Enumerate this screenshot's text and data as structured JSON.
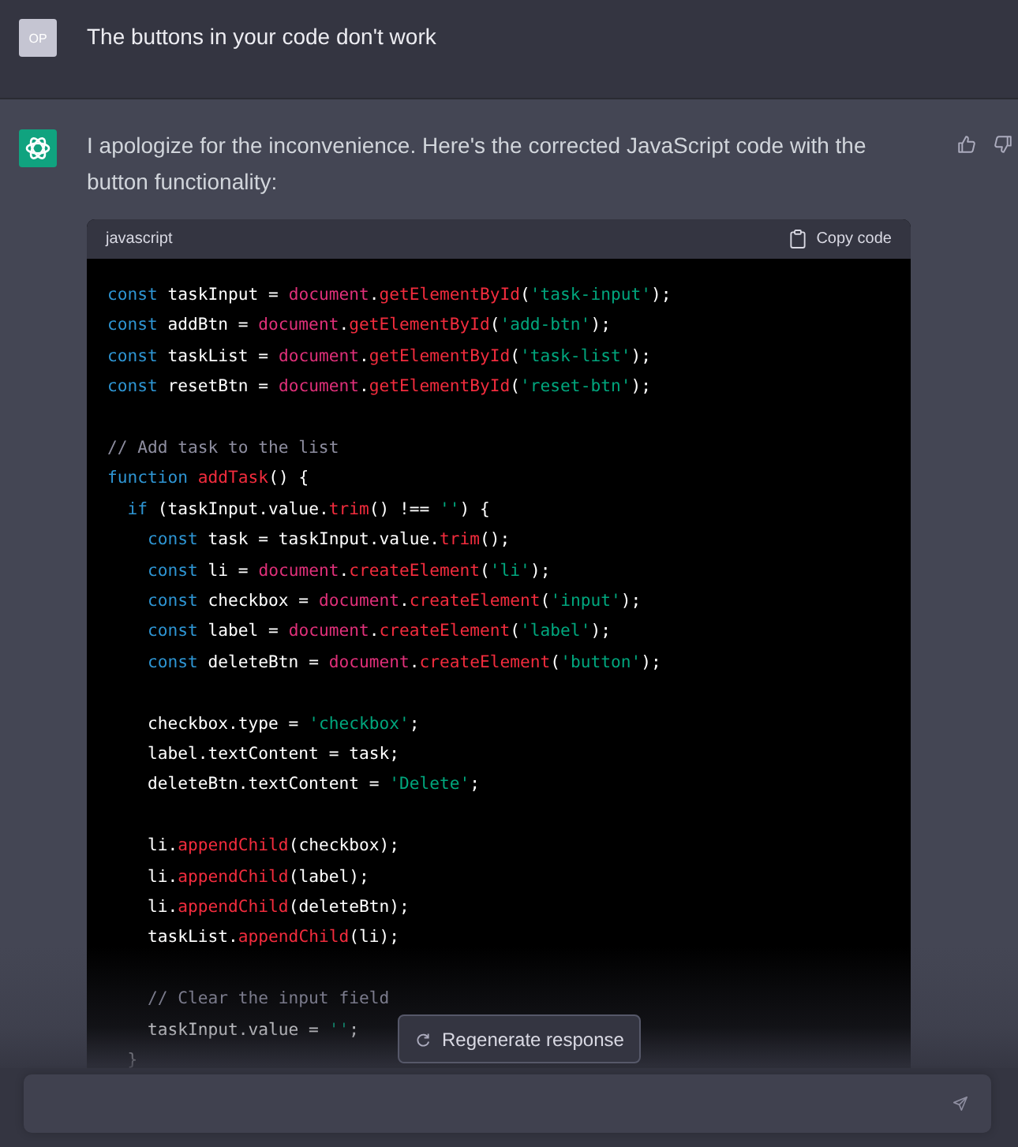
{
  "user_message": {
    "avatar": "OP",
    "text": "The buttons in your code don't work"
  },
  "assistant_message": {
    "text": "I apologize for the inconvenience. Here's the corrected JavaScript code with the button functionality:",
    "code_block": {
      "language": "javascript",
      "copy_label": "Copy code",
      "lines": [
        {
          "kind": "code",
          "tokens": [
            {
              "kind": "keyword",
              "text": "const"
            },
            {
              "kind": "plain",
              "text": " taskInput = "
            },
            {
              "kind": "object",
              "text": "document"
            },
            {
              "kind": "plain",
              "text": "."
            },
            {
              "kind": "method",
              "text": "getElementById"
            },
            {
              "kind": "plain",
              "text": "("
            },
            {
              "kind": "string",
              "text": "'task-input'"
            },
            {
              "kind": "plain",
              "text": ");"
            }
          ]
        },
        {
          "kind": "code",
          "tokens": [
            {
              "kind": "keyword",
              "text": "const"
            },
            {
              "kind": "plain",
              "text": " addBtn = "
            },
            {
              "kind": "object",
              "text": "document"
            },
            {
              "kind": "plain",
              "text": "."
            },
            {
              "kind": "method",
              "text": "getElementById"
            },
            {
              "kind": "plain",
              "text": "("
            },
            {
              "kind": "string",
              "text": "'add-btn'"
            },
            {
              "kind": "plain",
              "text": ");"
            }
          ]
        },
        {
          "kind": "code",
          "tokens": [
            {
              "kind": "keyword",
              "text": "const"
            },
            {
              "kind": "plain",
              "text": " taskList = "
            },
            {
              "kind": "object",
              "text": "document"
            },
            {
              "kind": "plain",
              "text": "."
            },
            {
              "kind": "method",
              "text": "getElementById"
            },
            {
              "kind": "plain",
              "text": "("
            },
            {
              "kind": "string",
              "text": "'task-list'"
            },
            {
              "kind": "plain",
              "text": ");"
            }
          ]
        },
        {
          "kind": "code",
          "tokens": [
            {
              "kind": "keyword",
              "text": "const"
            },
            {
              "kind": "plain",
              "text": " resetBtn = "
            },
            {
              "kind": "object",
              "text": "document"
            },
            {
              "kind": "plain",
              "text": "."
            },
            {
              "kind": "method",
              "text": "getElementById"
            },
            {
              "kind": "plain",
              "text": "("
            },
            {
              "kind": "string",
              "text": "'reset-btn'"
            },
            {
              "kind": "plain",
              "text": ");"
            }
          ]
        },
        {
          "kind": "blank"
        },
        {
          "kind": "code",
          "tokens": [
            {
              "kind": "comment",
              "text": "// Add task to the list"
            }
          ]
        },
        {
          "kind": "code",
          "tokens": [
            {
              "kind": "keyword",
              "text": "function "
            },
            {
              "kind": "method",
              "text": "addTask"
            },
            {
              "kind": "plain",
              "text": "() {"
            }
          ]
        },
        {
          "kind": "code",
          "tokens": [
            {
              "kind": "keyword",
              "text": "  if"
            },
            {
              "kind": "plain",
              "text": " (taskInput.value."
            },
            {
              "kind": "method",
              "text": "trim"
            },
            {
              "kind": "plain",
              "text": "() !== "
            },
            {
              "kind": "string",
              "text": "''"
            },
            {
              "kind": "plain",
              "text": ") {"
            }
          ]
        },
        {
          "kind": "code",
          "tokens": [
            {
              "kind": "keyword",
              "text": "    const"
            },
            {
              "kind": "plain",
              "text": " task = taskInput.value."
            },
            {
              "kind": "method",
              "text": "trim"
            },
            {
              "kind": "plain",
              "text": "();"
            }
          ]
        },
        {
          "kind": "code",
          "tokens": [
            {
              "kind": "keyword",
              "text": "    const"
            },
            {
              "kind": "plain",
              "text": " li = "
            },
            {
              "kind": "object",
              "text": "document"
            },
            {
              "kind": "plain",
              "text": "."
            },
            {
              "kind": "method",
              "text": "createElement"
            },
            {
              "kind": "plain",
              "text": "("
            },
            {
              "kind": "string",
              "text": "'li'"
            },
            {
              "kind": "plain",
              "text": ");"
            }
          ]
        },
        {
          "kind": "code",
          "tokens": [
            {
              "kind": "keyword",
              "text": "    const"
            },
            {
              "kind": "plain",
              "text": " checkbox = "
            },
            {
              "kind": "object",
              "text": "document"
            },
            {
              "kind": "plain",
              "text": "."
            },
            {
              "kind": "method",
              "text": "createElement"
            },
            {
              "kind": "plain",
              "text": "("
            },
            {
              "kind": "string",
              "text": "'input'"
            },
            {
              "kind": "plain",
              "text": ");"
            }
          ]
        },
        {
          "kind": "code",
          "tokens": [
            {
              "kind": "keyword",
              "text": "    const"
            },
            {
              "kind": "plain",
              "text": " label = "
            },
            {
              "kind": "object",
              "text": "document"
            },
            {
              "kind": "plain",
              "text": "."
            },
            {
              "kind": "method",
              "text": "createElement"
            },
            {
              "kind": "plain",
              "text": "("
            },
            {
              "kind": "string",
              "text": "'label'"
            },
            {
              "kind": "plain",
              "text": ");"
            }
          ]
        },
        {
          "kind": "code",
          "tokens": [
            {
              "kind": "keyword",
              "text": "    const"
            },
            {
              "kind": "plain",
              "text": " deleteBtn = "
            },
            {
              "kind": "object",
              "text": "document"
            },
            {
              "kind": "plain",
              "text": "."
            },
            {
              "kind": "method",
              "text": "createElement"
            },
            {
              "kind": "plain",
              "text": "("
            },
            {
              "kind": "string",
              "text": "'button'"
            },
            {
              "kind": "plain",
              "text": ");"
            }
          ]
        },
        {
          "kind": "blank"
        },
        {
          "kind": "code",
          "tokens": [
            {
              "kind": "plain",
              "text": "    checkbox.type = "
            },
            {
              "kind": "string",
              "text": "'checkbox'"
            },
            {
              "kind": "plain",
              "text": ";"
            }
          ]
        },
        {
          "kind": "code",
          "tokens": [
            {
              "kind": "plain",
              "text": "    label.textContent = task;"
            }
          ]
        },
        {
          "kind": "code",
          "tokens": [
            {
              "kind": "plain",
              "text": "    deleteBtn.textContent = "
            },
            {
              "kind": "string",
              "text": "'Delete'"
            },
            {
              "kind": "plain",
              "text": ";"
            }
          ]
        },
        {
          "kind": "blank"
        },
        {
          "kind": "code",
          "tokens": [
            {
              "kind": "plain",
              "text": "    li."
            },
            {
              "kind": "method",
              "text": "appendChild"
            },
            {
              "kind": "plain",
              "text": "(checkbox);"
            }
          ]
        },
        {
          "kind": "code",
          "tokens": [
            {
              "kind": "plain",
              "text": "    li."
            },
            {
              "kind": "method",
              "text": "appendChild"
            },
            {
              "kind": "plain",
              "text": "(label);"
            }
          ]
        },
        {
          "kind": "code",
          "tokens": [
            {
              "kind": "plain",
              "text": "    li."
            },
            {
              "kind": "method",
              "text": "appendChild"
            },
            {
              "kind": "plain",
              "text": "(deleteBtn);"
            }
          ]
        },
        {
          "kind": "code",
          "tokens": [
            {
              "kind": "plain",
              "text": "    taskList."
            },
            {
              "kind": "method",
              "text": "appendChild"
            },
            {
              "kind": "plain",
              "text": "(li);"
            }
          ]
        },
        {
          "kind": "blank"
        },
        {
          "kind": "code",
          "tokens": [
            {
              "kind": "comment",
              "text": "    // Clear the input field"
            }
          ]
        },
        {
          "kind": "code",
          "tokens": [
            {
              "kind": "plain",
              "text": "    taskInput.value = "
            },
            {
              "kind": "string",
              "text": "''"
            },
            {
              "kind": "plain",
              "text": ";"
            }
          ]
        },
        {
          "kind": "code",
          "tokens": [
            {
              "kind": "plain",
              "text": "  }"
            }
          ]
        }
      ]
    }
  },
  "regenerate_button": {
    "label": "Regenerate response"
  }
}
